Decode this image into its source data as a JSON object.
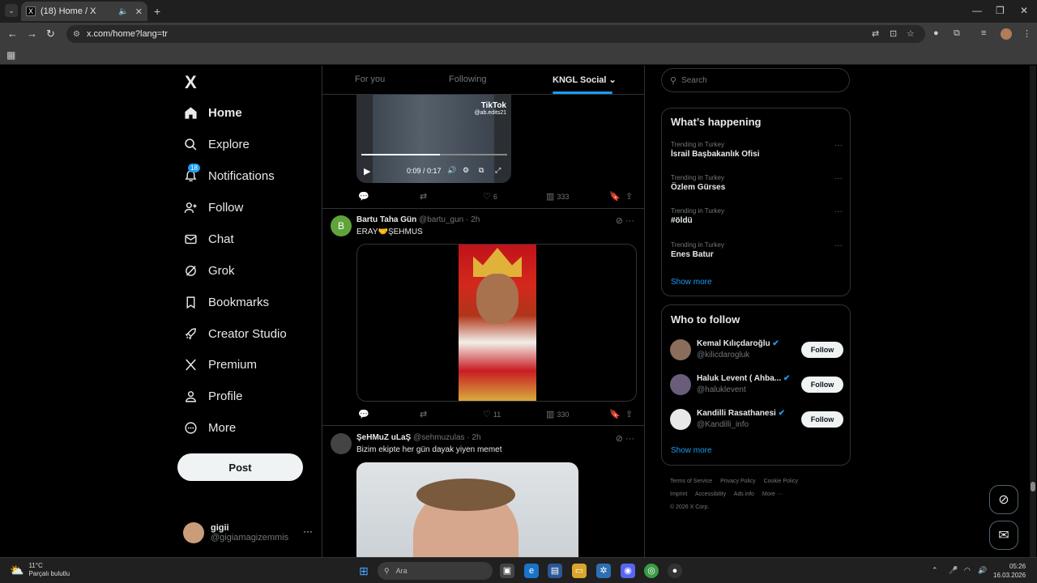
{
  "browser": {
    "tab_title": "(18) Home / X",
    "tab_icon": "X",
    "url": "x.com/home?lang=tr"
  },
  "sidebar": {
    "logo": "X",
    "items": [
      {
        "label": "Home",
        "icon": "home-icon"
      },
      {
        "label": "Explore",
        "icon": "search-icon"
      },
      {
        "label": "Notifications",
        "icon": "bell-icon",
        "badge": "18"
      },
      {
        "label": "Follow",
        "icon": "person-add-icon"
      },
      {
        "label": "Chat",
        "icon": "mail-icon"
      },
      {
        "label": "Grok",
        "icon": "grok-icon"
      },
      {
        "label": "Bookmarks",
        "icon": "bookmark-icon"
      },
      {
        "label": "Creator Studio",
        "icon": "rocket-icon"
      },
      {
        "label": "Premium",
        "icon": "x-icon"
      },
      {
        "label": "Profile",
        "icon": "person-icon"
      },
      {
        "label": "More",
        "icon": "more-circle-icon"
      }
    ],
    "post_label": "Post",
    "account": {
      "name": "gigii",
      "handle": "@gigiamagizemmis"
    }
  },
  "feed": {
    "tabs": [
      "For you",
      "Following",
      "KNGL Social"
    ],
    "video": {
      "brand": "TikTok",
      "brand_handle": "@ab.edits21",
      "time": "0:09 / 0:17",
      "progress": 0.54
    },
    "tweet0_actions": {
      "reply": "",
      "retweet": "",
      "like": "6",
      "views": "333"
    },
    "tweets": [
      {
        "name": "Bartu Taha Gün",
        "handle": "@bartu_gun",
        "time": "· 2h",
        "text": "ERAY🤝ŞEHMUS",
        "avatar_letter": "B",
        "actions": {
          "reply": "",
          "retweet": "",
          "like": "11",
          "views": "330"
        }
      },
      {
        "name": "ŞeHMuZ uLaŞ",
        "handle": "@sehmuzulas",
        "time": "· 2h",
        "text": "Bizim ekipte her gün dayak yiyen memet"
      }
    ]
  },
  "right": {
    "search_placeholder": "Search",
    "happening": {
      "title": "What’s happening",
      "trends": [
        {
          "context": "Trending in Turkey",
          "name": "İsrail Başbakanlık Ofisi"
        },
        {
          "context": "Trending in Turkey",
          "name": "Özlem Gürses"
        },
        {
          "context": "Trending in Turkey",
          "name": "#öldü"
        },
        {
          "context": "Trending in Turkey",
          "name": "Enes Batur"
        }
      ],
      "show_more": "Show more"
    },
    "who_to_follow": {
      "title": "Who to follow",
      "people": [
        {
          "name": "Kemal Kılıçdaroğlu",
          "handle": "@kilicdarogluk",
          "button": "Follow"
        },
        {
          "name": "Haluk Levent ( Ahba...",
          "handle": "@haluklevent",
          "button": "Follow"
        },
        {
          "name": "Kandilli Rasathanesi",
          "handle": "@Kandilli_info",
          "button": "Follow"
        }
      ],
      "show_more": "Show more"
    },
    "footer": [
      "Terms of Service",
      "Privacy Policy",
      "Cookie Policy",
      "Imprint",
      "Accessibility",
      "Ads info",
      "More ···",
      "© 2026 X Corp."
    ]
  },
  "taskbar": {
    "weather_temp": "11°C",
    "weather_desc": "Parçalı bulutlu",
    "search_placeholder": "Ara",
    "time": "05:26",
    "date": "16.03.2026"
  },
  "colors": {
    "accent": "#1d9bf0",
    "background": "#000000",
    "border": "#2f3336",
    "muted": "#71767b"
  }
}
